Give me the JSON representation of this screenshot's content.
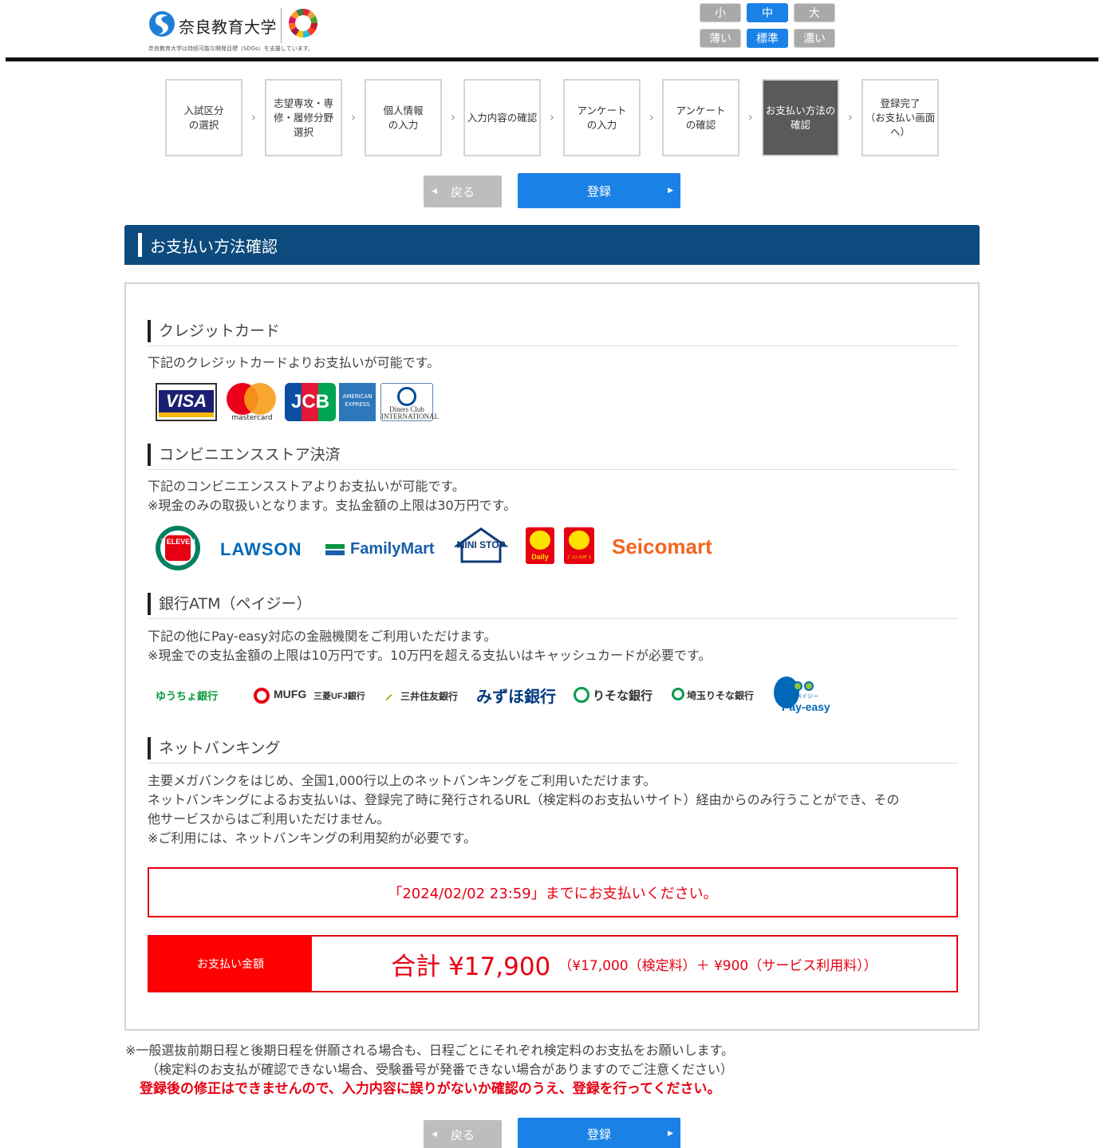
{
  "header": {
    "university_name": "奈良教育大学",
    "caption": "奈良教育大学は持続可能な開発目標（SDGs）を支援しています。",
    "font_size_buttons": [
      "小",
      "中",
      "大"
    ],
    "contrast_buttons": [
      "薄い",
      "標準",
      "濃い"
    ],
    "selected_font_size": "中",
    "selected_contrast": "標準"
  },
  "steps": [
    {
      "label": "入試区分\nの選択"
    },
    {
      "label": "志望専攻・専\n修・履修分野\n選択"
    },
    {
      "label": "個人情報\nの入力"
    },
    {
      "label": "入力内容の確認"
    },
    {
      "label": "アンケート\nの入力"
    },
    {
      "label": "アンケート\nの確認"
    },
    {
      "label": "お支払い方法の\n確認",
      "active": true
    },
    {
      "label": "登録完了\n（お支払い画面\nへ）"
    }
  ],
  "buttons": {
    "back": "戻る",
    "register": "登録"
  },
  "section_title": "お支払い方法確認",
  "credit": {
    "heading": "クレジットカード",
    "description": "下記のクレジットカードよりお支払いが可能です。",
    "logos": [
      "VISA",
      "mastercard",
      "JCB",
      "AMERICAN EXPRESS",
      "Diners Club INTERNATIONAL"
    ]
  },
  "convenience": {
    "heading": "コンビニエンスストア決済",
    "description": "下記のコンビニエンスストアよりお支払いが可能です。\n※現金のみの取扱いとなります。支払金額の上限は30万円です。",
    "logos": [
      "7 ELEVEN",
      "LAWSON",
      "FamilyMart",
      "MINI STOP",
      "Daily",
      "ﾃﾞｲﾘｰﾔﾏｻﾞｷ",
      "Seicomart"
    ]
  },
  "atm": {
    "heading": "銀行ATM（ペイジー）",
    "description": "下記の他にPay-easy対応の金融機関をご利用いただけます。\n※現金での支払金額の上限は10万円です。10万円を超える支払いはキャッシュカードが必要です。",
    "banks": [
      "ゆうちょ銀行",
      "MUFG",
      "三菱UFJ銀行",
      "三井住友銀行",
      "みずほ銀行",
      "りそな銀行",
      "埼玉りそな銀行",
      "Pay-easy",
      "ペイジー"
    ]
  },
  "netbanking": {
    "heading": "ネットバンキング",
    "description": "主要メガバンクをはじめ、全国1,000行以上のネットバンキングをご利用いただけます。\nネットバンキングによるお支払いは、登録完了時に発行されるURL（検定料のお支払いサイト）経由からのみ行うことができ、その\n他サービスからはご利用いただけません。\n※ご利用には、ネットバンキングの利用契約が必要です。"
  },
  "deadline": "「2024/02/02 23:59」までにお支払いください。",
  "payment": {
    "label": "お支払い金額",
    "total": "合計 ¥17,900",
    "breakdown": "（¥17,000（検定料）＋ ¥900（サービス利用料））"
  },
  "notes": {
    "line1": "※一般選抜前期日程と後期日程を併願される場合も、日程ごとにそれぞれ検定料のお支払をお願いします。",
    "line2": "（検定料のお支払が確認できない場合、受験番号が発番できない場合がありますのでご注意ください）",
    "warning": "登録後の修正はできませんので、入力内容に誤りがないか確認のうえ、登録を行ってください。"
  },
  "colors": {
    "accent_blue": "#1a82e6",
    "section_navy": "#0d4a7d",
    "alert_red": "#e60012",
    "active_step": "#5a5a5a"
  }
}
